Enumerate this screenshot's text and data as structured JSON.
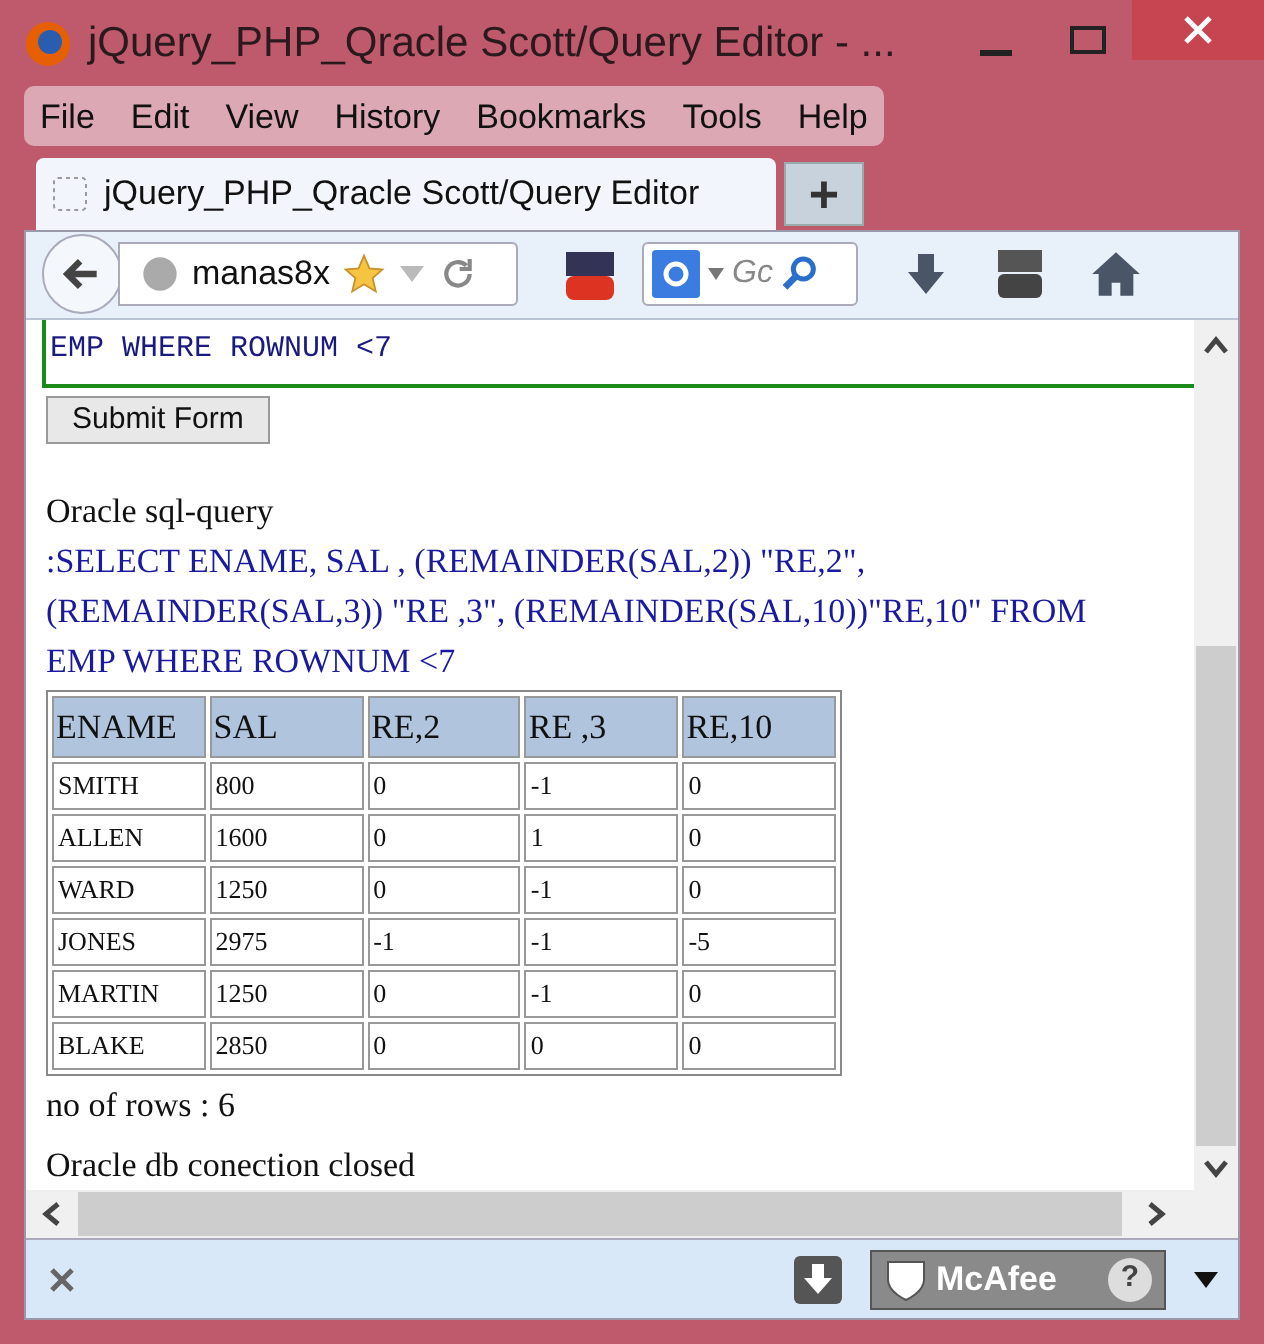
{
  "window": {
    "title": "jQuery_PHP_Qracle Scott/Query Editor - ..."
  },
  "menu": [
    "File",
    "Edit",
    "View",
    "History",
    "Bookmarks",
    "Tools",
    "Help"
  ],
  "tabs": [
    {
      "label": "jQuery_PHP_Qracle Scott/Query Editor",
      "selected": true
    }
  ],
  "new_tab": "+",
  "toolbar": {
    "url": "manas8x",
    "search_placeholder": "Gc"
  },
  "form": {
    "query_tail": "EMP WHERE ROWNUM <7",
    "submit": "Submit Form"
  },
  "result": {
    "heading": "Oracle sql-query",
    "query": ":SELECT ENAME, SAL , (REMAINDER(SAL,2)) \"RE,2\", (REMAINDER(SAL,3)) \"RE ,3\", (REMAINDER(SAL,10))\"RE,10\" FROM EMP WHERE ROWNUM <7",
    "table": {
      "columns": [
        "ENAME",
        "SAL",
        "RE,2",
        "RE ,3",
        "RE,10"
      ],
      "rows": [
        [
          "SMITH",
          "800",
          "0",
          "-1",
          "0"
        ],
        [
          "ALLEN",
          "1600",
          "0",
          "1",
          "0"
        ],
        [
          "WARD",
          "1250",
          "0",
          "-1",
          "0"
        ],
        [
          "JONES",
          "2975",
          "-1",
          "-1",
          "-5"
        ],
        [
          "MARTIN",
          "1250",
          "0",
          "-1",
          "0"
        ],
        [
          "BLAKE",
          "2850",
          "0",
          "0",
          "0"
        ]
      ]
    },
    "row_count": "no of rows : 6",
    "status": "Oracle db conection closed"
  },
  "addon_bar": {
    "badge": "McAfee",
    "help": "?"
  }
}
